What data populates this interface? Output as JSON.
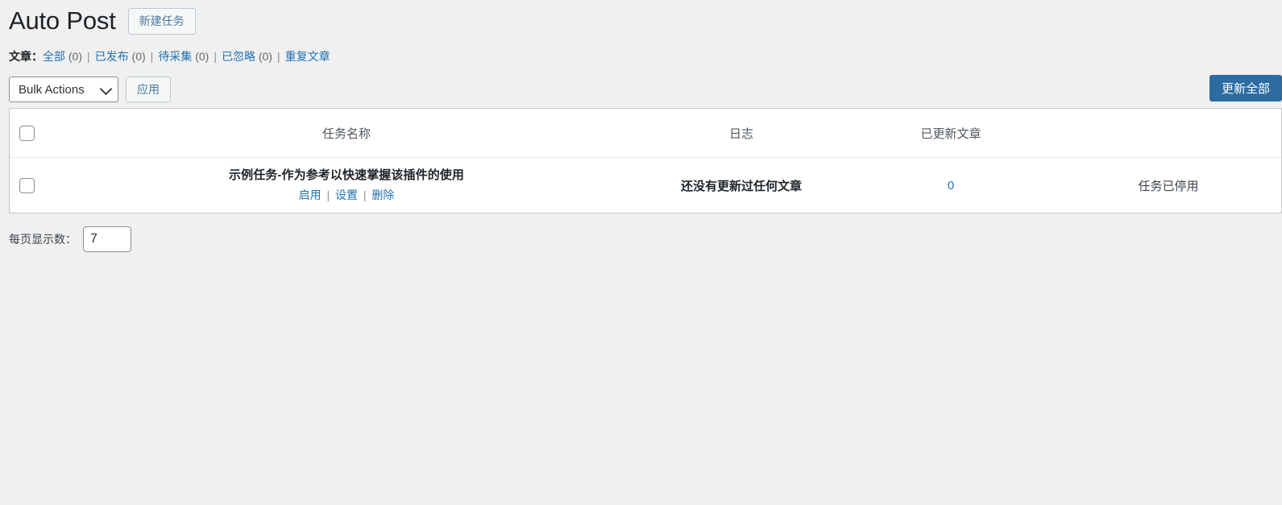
{
  "header": {
    "title": "Auto Post",
    "new_task_button": "新建任务"
  },
  "filters": {
    "lead_label": "文章",
    "lead_separator": "：",
    "separator": "|",
    "items": [
      {
        "label": "全部",
        "count": "(0)"
      },
      {
        "label": "已发布",
        "count": "(0)"
      },
      {
        "label": "待采集",
        "count": "(0)"
      },
      {
        "label": "已忽略",
        "count": "(0)"
      },
      {
        "label": "重复文章",
        "count": ""
      }
    ]
  },
  "tablenav": {
    "bulk_actions_label": "Bulk Actions",
    "apply_button": "应用",
    "update_all_button": "更新全部"
  },
  "table": {
    "columns": {
      "checkbox": "",
      "name": "任务名称",
      "log": "日志",
      "updated": "已更新文章",
      "status": ""
    },
    "rows": [
      {
        "name": "示例任务-作为参考以快速掌握该插件的使用",
        "actions": [
          {
            "label": "启用"
          },
          {
            "label": "设置"
          },
          {
            "label": "删除"
          }
        ],
        "action_separator": "|",
        "log": "还没有更新过任何文章",
        "updated_count": "0",
        "status": "任务已停用"
      }
    ]
  },
  "footer": {
    "per_page_label": "每页显示数：",
    "per_page_value": "7"
  },
  "colors": {
    "page_background": "#f0f0f1",
    "link": "#2271b1",
    "primary_button": "#2d6ca2",
    "secondary_button_text": "#4a7ba0",
    "title": "#1d2327"
  }
}
